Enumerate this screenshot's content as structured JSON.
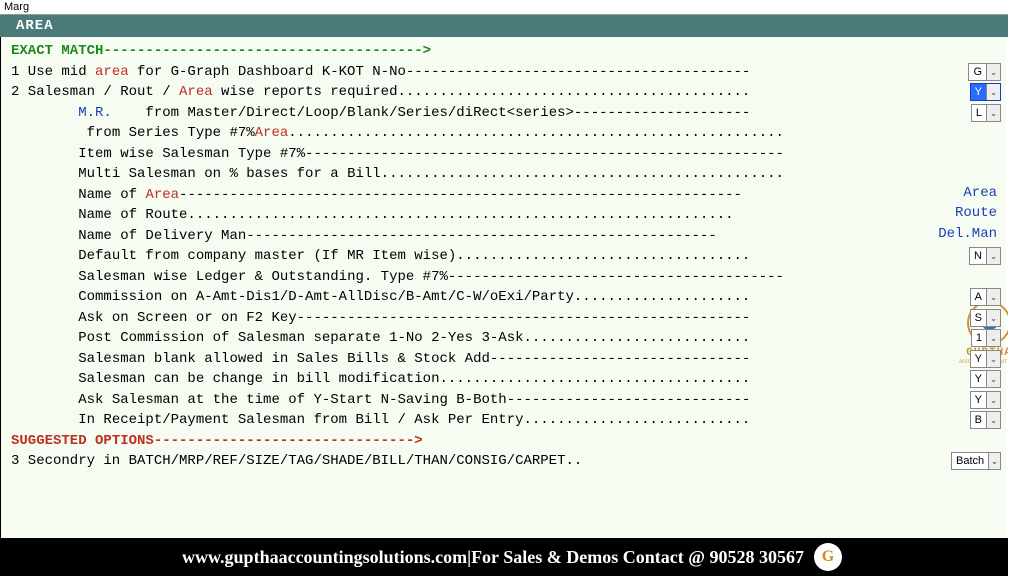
{
  "window_title": "Marg",
  "header": "AREA",
  "sections": {
    "exact_match": "EXACT MATCH",
    "suggested": "SUGGESTED OPTIONS"
  },
  "arrow": "-------------------------------------->",
  "arrow2": "------------------------------->",
  "lines": [
    {
      "num": "1",
      "pretext": "Use mid ",
      "red": "area",
      "posttext": " for G-Graph Dashboard K-KOT N-No",
      "fill": "-",
      "select": "G"
    },
    {
      "num": "2",
      "pretext": "Salesman / Rout / ",
      "red": "Area",
      "posttext": " wise reports required",
      "fill": ".",
      "select": "Y",
      "highlight": true
    },
    {
      "num": "",
      "indent": 1,
      "blue": "M.R.",
      "pretext": "    from Master/Direct/Loop/Blank/Series/diRect<series>",
      "fill": "-",
      "select": "L"
    },
    {
      "num": "",
      "indent": 1,
      "red": "Area",
      "pretext": " from Series Type #7%",
      "fill": "."
    },
    {
      "num": "",
      "indent": 1,
      "pretext": "Item wise Salesman Type #7%",
      "fill": "-"
    },
    {
      "num": "",
      "indent": 1,
      "pretext": "Multi Salesman on % bases for a Bill",
      "fill": "."
    },
    {
      "num": "",
      "indent": 1,
      "pretext": "Name of ",
      "red": "Area",
      "fill": "-",
      "value_text": "Area",
      "value_class": "blue"
    },
    {
      "num": "",
      "indent": 1,
      "pretext": "Name of Route",
      "fill": ".",
      "value_text": "Route",
      "value_class": "blue"
    },
    {
      "num": "",
      "indent": 1,
      "pretext": "Name of Delivery Man",
      "fill": "-",
      "value_text": "Del.Man",
      "value_class": "blue"
    },
    {
      "num": "",
      "indent": 1,
      "pretext": "Default from company master (If MR Item wise)",
      "fill": ".",
      "select": "N"
    },
    {
      "num": "",
      "indent": 1,
      "pretext": "Salesman wise Ledger & Outstanding. Type #7%",
      "fill": "-"
    },
    {
      "num": "",
      "indent": 1,
      "pretext": "Commission on A-Amt-Dis1/D-Amt-AllDisc/B-Amt/C-W/oExi/Party",
      "fill": ".",
      "select": "A"
    },
    {
      "num": "",
      "indent": 1,
      "pretext": "Ask on Screen or on F2 Key",
      "fill": "-",
      "select": "S"
    },
    {
      "num": "",
      "indent": 1,
      "pretext": "Post Commission of Salesman separate 1-No 2-Yes 3-Ask",
      "fill": ".",
      "select": "1"
    },
    {
      "num": "",
      "indent": 1,
      "pretext": "Salesman blank allowed in Sales Bills & Stock Add",
      "fill": "-",
      "select": "Y"
    },
    {
      "num": "",
      "indent": 1,
      "pretext": "Salesman can be change in bill modification",
      "fill": ".",
      "select": "Y"
    },
    {
      "num": "",
      "indent": 1,
      "pretext": "Ask Salesman at the time of Y-Start N-Saving B-Both",
      "fill": "-",
      "select": "Y"
    },
    {
      "num": "",
      "indent": 1,
      "pretext": "In Receipt/Payment Salesman from Bill / Ask Per Entry",
      "fill": ".",
      "select": "B"
    }
  ],
  "line3": {
    "num": "3",
    "text": "Secondry in BATCH/MRP/REF/SIZE/TAG/SHADE/BILL/THAN/CONSIG/CARPET..",
    "select": "Batch",
    "wide": true
  },
  "watermark": {
    "name": "GUPTHA",
    "sub": "ACCOUNTING SOLUTIONS"
  },
  "footer": {
    "site": "www.gupthaaccountingsolutions.com",
    "sep": " | ",
    "contact": "For Sales & Demos Contact @ 90528 30567"
  }
}
